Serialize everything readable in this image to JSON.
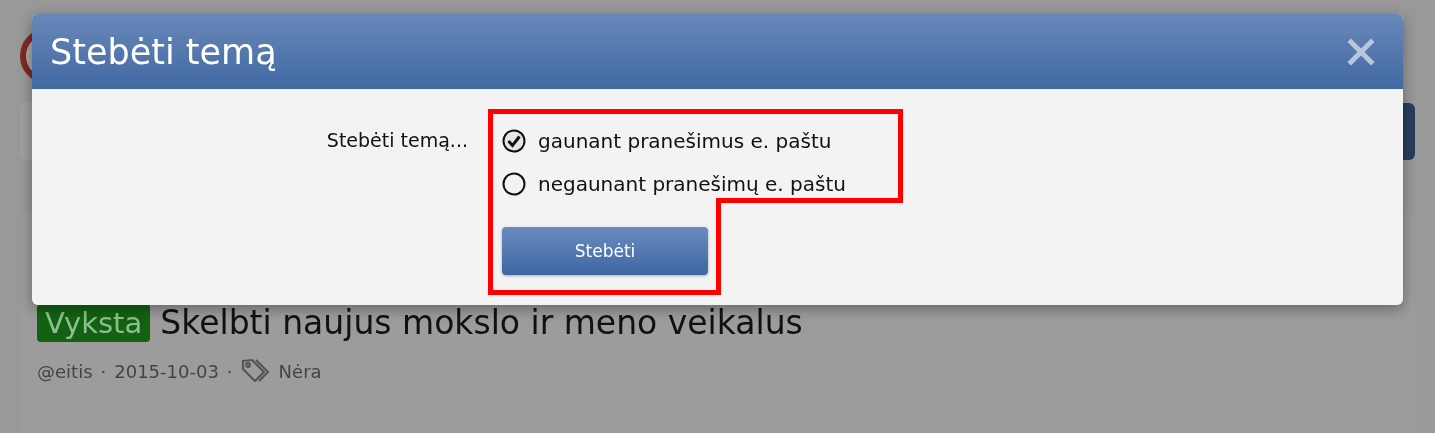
{
  "background_page": {
    "status_badge": "Vyksta",
    "topic_title": "Skelbti naujus mokslo ir meno veikalus",
    "author": "@eitis",
    "separator_1": "·",
    "date": "2015-10-03",
    "separator_2": "·",
    "tags": "Nėra"
  },
  "dialog": {
    "title": "Stebėti temą",
    "field_label": "Stebėti temą...",
    "options": [
      {
        "label": "gaunant pranešimus e. paštu",
        "selected": true
      },
      {
        "label": "negaunant pranešimų e. paštu",
        "selected": false
      }
    ],
    "submit": "Stebėti"
  }
}
